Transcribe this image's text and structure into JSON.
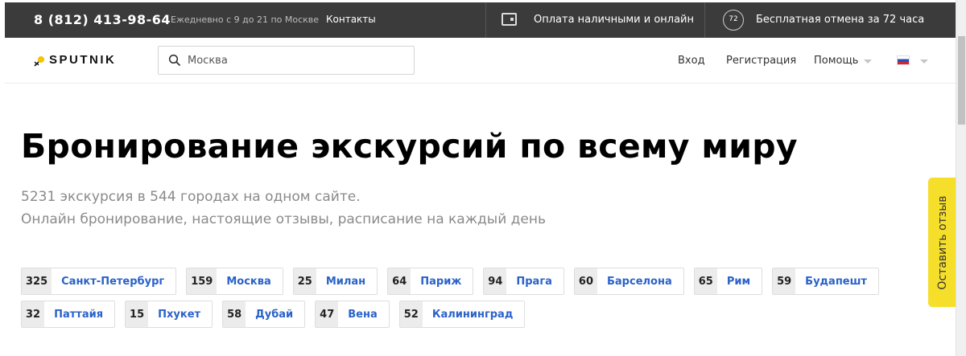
{
  "topbar": {
    "phone": "8 (812) 413-98-64",
    "hours": "Ежедневно с 9 до 21 по Москве",
    "contacts": "Контакты",
    "payment": "Оплата наличными и онлайн",
    "cancel_badge": "72",
    "cancel": "Бесплатная отмена за 72 часа"
  },
  "header": {
    "logo": "SPUTNIK",
    "search_placeholder": "Москва",
    "login": "Вход",
    "register": "Регистрация",
    "help": "Помощь",
    "language_icon": "russian-flag-icon"
  },
  "hero": {
    "title": "Бронирование экскурсий по всему миру",
    "subtitle_line1": "5231 экскурсия в 544 городах на одном сайте.",
    "subtitle_line2": "Онлайн бронирование, настоящие отзывы, расписание на каждый день"
  },
  "cities": {
    "row1": [
      {
        "count": "325",
        "name": "Санкт-Петербург"
      },
      {
        "count": "159",
        "name": "Москва"
      },
      {
        "count": "25",
        "name": "Милан"
      },
      {
        "count": "64",
        "name": "Париж"
      },
      {
        "count": "94",
        "name": "Прага"
      },
      {
        "count": "60",
        "name": "Барселона"
      },
      {
        "count": "65",
        "name": "Рим"
      },
      {
        "count": "59",
        "name": "Будапешт"
      }
    ],
    "row2": [
      {
        "count": "32",
        "name": "Паттайя"
      },
      {
        "count": "15",
        "name": "Пхукет"
      },
      {
        "count": "58",
        "name": "Дубай"
      },
      {
        "count": "47",
        "name": "Вена"
      },
      {
        "count": "52",
        "name": "Калининград"
      }
    ]
  },
  "feedback": {
    "label": "Оставить отзыв"
  },
  "colors": {
    "topbar_bg": "#3b3b3b",
    "link_blue": "#2a62c9",
    "feedback_yellow": "#f6df2b",
    "logo_accent": "#f5c400"
  }
}
